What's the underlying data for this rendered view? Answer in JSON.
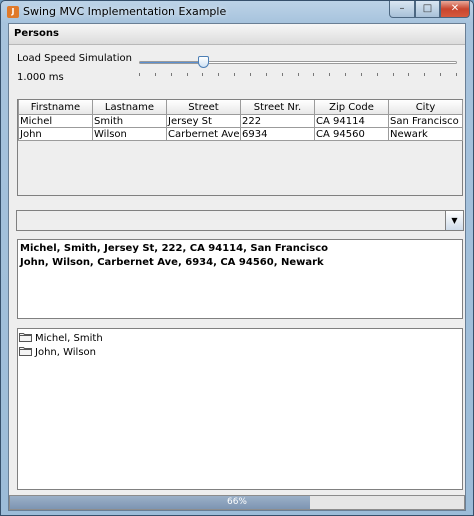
{
  "window": {
    "title": "Swing MVC Implementation Example",
    "minimize": "–",
    "maximize": "□",
    "close": "✕"
  },
  "panel": {
    "header": "Persons"
  },
  "speed": {
    "label": "Load Speed Simulation",
    "value_text": "1.000 ms",
    "slider_fraction": 0.2
  },
  "table": {
    "columns": [
      "Firstname",
      "Lastname",
      "Street",
      "Street Nr.",
      "Zip Code",
      "City"
    ],
    "rows": [
      [
        "Michel",
        "Smith",
        "Jersey St",
        "222",
        "CA 94114",
        "San Francisco"
      ],
      [
        "John",
        "Wilson",
        "Carbernet Ave",
        "6934",
        "CA 94560",
        "Newark"
      ]
    ]
  },
  "combo": {
    "selected": "",
    "arrow": "▼"
  },
  "textarea": {
    "lines": [
      "Michel, Smith, Jersey St, 222, CA 94114, San Francisco",
      "John, Wilson, Carbernet Ave, 6934, CA 94560, Newark"
    ]
  },
  "tree": {
    "items": [
      "Michel, Smith",
      "John, Wilson"
    ]
  },
  "progress": {
    "text": "66%",
    "fraction": 0.66
  },
  "colors": {
    "accent": "#4d7fb5",
    "progress": "#7d95b2",
    "close": "#c8452e"
  }
}
